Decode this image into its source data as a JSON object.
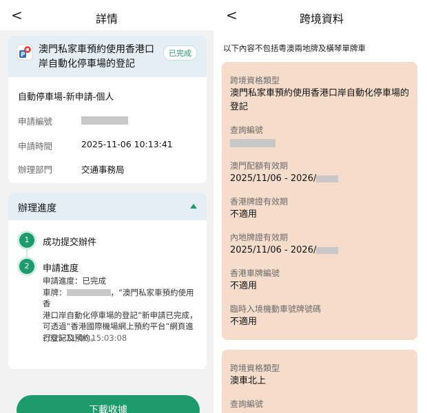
{
  "left": {
    "header_title": "詳情",
    "back_glyph": "<",
    "application": {
      "title": "澳門私家車預約使用香港口岸自動化停車場的登記",
      "status": "已完成",
      "subtitle": "自動停車場-新申請-個人",
      "fields": [
        {
          "label": "申請編號",
          "value": ""
        },
        {
          "label": "申請時間",
          "value": "2025-11-06 10:13:41"
        },
        {
          "label": "辦理部門",
          "value": "交通事務局"
        }
      ]
    },
    "progress": {
      "title": "辦理進度",
      "steps": [
        {
          "num": "1",
          "title": "成功提交辦件"
        },
        {
          "num": "2",
          "title": "申請進度",
          "lines": [
            "申請進度：已完成",
            "車牌：",
            "，“澳門私家車預約使用香",
            "港口岸自動化停車場的登記”新申請已完成，",
            "可透過“香港國際機場網上預約平台”網頁進",
            "行登記及預約。"
          ],
          "time": "2025-11-06 15:03:08"
        }
      ]
    },
    "download_button": "下載收據"
  },
  "right": {
    "header_title": "跨境資料",
    "back_glyph": "<",
    "notice": "以下內容不包括粵澳兩地牌及橫琴單牌車",
    "card1": [
      {
        "label": "跨境資格類型",
        "value": "澳門私家車預約使用香港口岸自動化停車場的登記"
      },
      {
        "label": "查詢編號",
        "value": ""
      },
      {
        "label": "澳門配額有效期",
        "value": "2025/11/06 - 2026/"
      },
      {
        "label": "香港牌證有效期",
        "value": "不適用"
      },
      {
        "label": "內地牌證有效期",
        "value": "2025/11/06 - 2026/"
      },
      {
        "label": "香港車牌編號",
        "value": "不適用"
      },
      {
        "label": "臨時入境機動車號牌號碼",
        "value": "不適用"
      }
    ],
    "card2": [
      {
        "label": "跨境資格類型",
        "value": "澳車北上"
      },
      {
        "label": "查詢編號",
        "value": ""
      }
    ]
  },
  "colors": {
    "accent": "#1e9b6c",
    "card_head": "#e6eef5",
    "info_card": "#f5dccb"
  }
}
